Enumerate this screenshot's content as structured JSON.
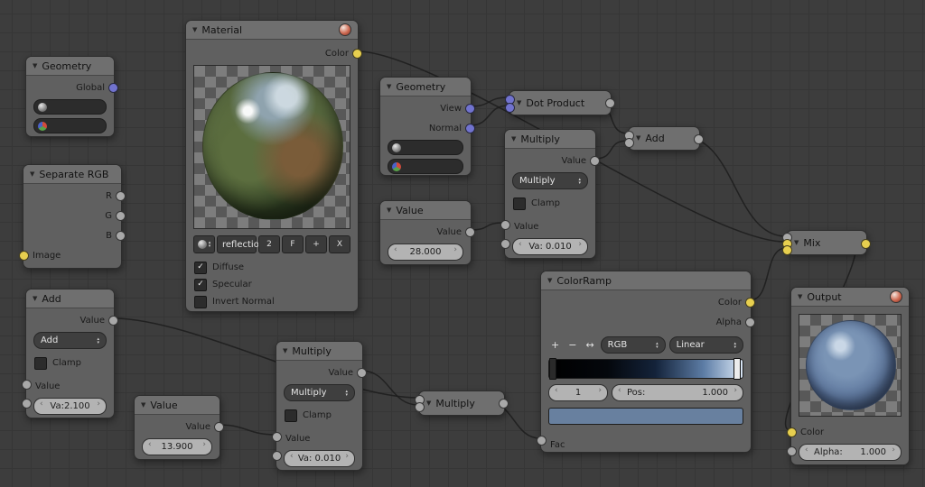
{
  "ui": {
    "collapse_arrow": "▼",
    "check": "✓",
    "arrow_left": "‹",
    "arrow_right": "›"
  },
  "colors": {
    "socket_color": "#e7cf4f",
    "socket_vector": "#7173ce",
    "socket_value": "#a8a8a8",
    "ramp_swatch": "#68809f"
  },
  "nodes": {
    "geometry1": {
      "title": "Geometry",
      "global_label": "Global"
    },
    "separate_rgb": {
      "title": "Separate RGB",
      "r_label": "R",
      "g_label": "G",
      "b_label": "B",
      "image_label": "Image"
    },
    "material": {
      "title": "Material",
      "color_label": "Color",
      "name": "reflection",
      "users": "2",
      "fake_user": "F",
      "add_new": "+",
      "unlink": "X",
      "diffuse_label": "Diffuse",
      "diffuse_check": "✓",
      "specular_label": "Specular",
      "specular_check": "✓",
      "invert_label": "Invert Normal",
      "invert_check": ""
    },
    "geometry2": {
      "title": "Geometry",
      "view_label": "View",
      "normal_label": "Normal"
    },
    "value1": {
      "title": "Value",
      "out_label": "Value",
      "value": "28.000"
    },
    "dot_product": {
      "title": "Dot Product"
    },
    "multiply1": {
      "title": "Multiply",
      "out_label": "Value",
      "operation": "Multiply",
      "clamp_label": "Clamp",
      "clamp_check": "",
      "in1_label": "Value",
      "in2_value": "Va: 0.010"
    },
    "add_mini": {
      "title": "Add"
    },
    "add1": {
      "title": "Add",
      "out_label": "Value",
      "operation": "Add",
      "clamp_label": "Clamp",
      "clamp_check": "",
      "in1_label": "Value",
      "in2_value": "Va:2.100"
    },
    "value2": {
      "title": "Value",
      "out_label": "Value",
      "value": "13.900"
    },
    "multiply2": {
      "title": "Multiply",
      "out_label": "Value",
      "operation": "Multiply",
      "clamp_label": "Clamp",
      "clamp_check": "",
      "in1_label": "Value",
      "in2_value": "Va: 0.010"
    },
    "multiply_mini": {
      "title": "Multiply"
    },
    "colorramp": {
      "title": "ColorRamp",
      "color_label": "Color",
      "alpha_label": "Alpha",
      "add_btn": "+",
      "delete_btn": "−",
      "flip_btn": "↔",
      "mode": "RGB",
      "interpolation": "Linear",
      "index": "1",
      "pos_label": "Pos:",
      "pos_value": "1.000",
      "fac_label": "Fac"
    },
    "mix": {
      "title": "Mix"
    },
    "output": {
      "title": "Output",
      "color_label": "Color",
      "alpha_label": "Alpha:",
      "alpha_value": "1.000"
    }
  },
  "wires": [
    [
      396,
      57,
      868,
      268
    ],
    [
      520,
      118,
      563,
      108
    ],
    [
      520,
      139,
      563,
      117
    ],
    [
      658,
      112,
      695,
      148
    ],
    [
      658,
      176,
      695,
      156
    ],
    [
      520,
      255,
      558,
      247
    ],
    [
      757,
      152,
      870,
      262
    ],
    [
      830,
      333,
      870,
      275
    ],
    [
      942,
      268,
      875,
      477
    ],
    [
      125,
      353,
      463,
      441
    ],
    [
      242,
      471,
      305,
      482
    ],
    [
      400,
      411,
      463,
      449
    ],
    [
      540,
      446,
      598,
      486
    ]
  ]
}
